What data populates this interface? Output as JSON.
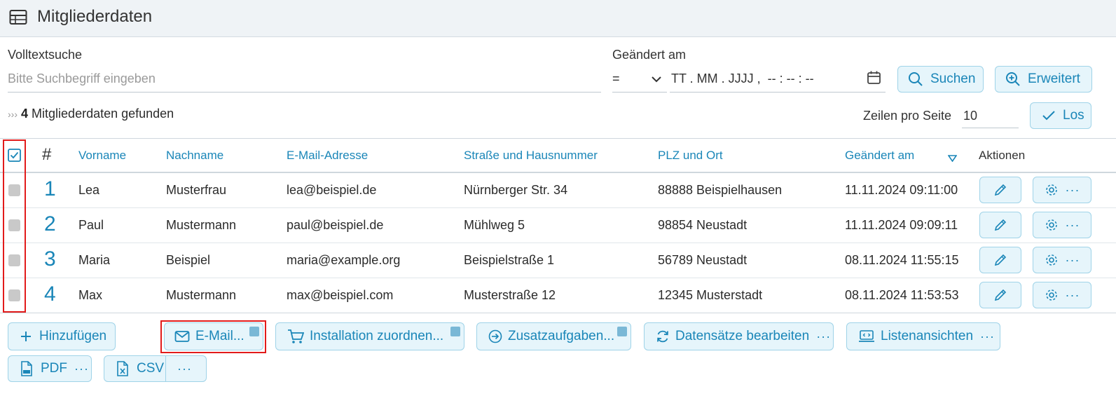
{
  "header": {
    "title": "Mitgliederdaten",
    "icon": "table-icon"
  },
  "search": {
    "fulltext_label": "Volltextsuche",
    "fulltext_placeholder": "Bitte Suchbegriff eingeben",
    "changed_label": "Geändert am",
    "operator": "=",
    "date_placeholder": "TT . MM . JJJJ ,  -- : -- : --",
    "search_button": "Suchen",
    "advanced_button": "Erweitert"
  },
  "results": {
    "prefix": "›››",
    "count": "4",
    "text": "Mitgliederdaten gefunden",
    "rows_per_page_label": "Zeilen pro Seite",
    "rows_per_page": "10",
    "go_button": "Los"
  },
  "table": {
    "columns": [
      "#",
      "Vorname",
      "Nachname",
      "E-Mail-Adresse",
      "Straße und Hausnummer",
      "PLZ und Ort",
      "Geändert am",
      "Aktionen"
    ],
    "rows": [
      {
        "num": "1",
        "vorname": "Lea",
        "nachname": "Musterfrau",
        "email": "lea@beispiel.de",
        "strasse": "Nürnberger Str. 34",
        "ort": "88888 Beispielhausen",
        "geaendert": "11.11.2024 09:11:00"
      },
      {
        "num": "2",
        "vorname": "Paul",
        "nachname": "Mustermann",
        "email": "paul@beispiel.de",
        "strasse": "Mühlweg 5",
        "ort": "98854 Neustadt",
        "geaendert": "11.11.2024 09:09:11"
      },
      {
        "num": "3",
        "vorname": "Maria",
        "nachname": "Beispiel",
        "email": "maria@example.org",
        "strasse": "Beispielstraße 1",
        "ort": "56789 Neustadt",
        "geaendert": "08.11.2024 11:55:15"
      },
      {
        "num": "4",
        "vorname": "Max",
        "nachname": "Mustermann",
        "email": "max@beispiel.com",
        "strasse": "Musterstraße 12",
        "ort": "12345 Musterstadt",
        "geaendert": "08.11.2024 11:53:53"
      }
    ],
    "more_dots": "···"
  },
  "toolbar": {
    "add": "Hinzufügen",
    "email": "E-Mail...",
    "installation": "Installation zuordnen...",
    "extra": "Zusatzaufgaben...",
    "edit_records": "Datensätze bearbeiten",
    "list_views": "Listenansichten",
    "pdf": "PDF",
    "csv": "CSV",
    "dots": "···"
  },
  "colors": {
    "accent": "#1a86b8",
    "button_bg": "#e6f5fb",
    "button_border": "#9fd3e8",
    "highlight": "#e21b1b"
  }
}
